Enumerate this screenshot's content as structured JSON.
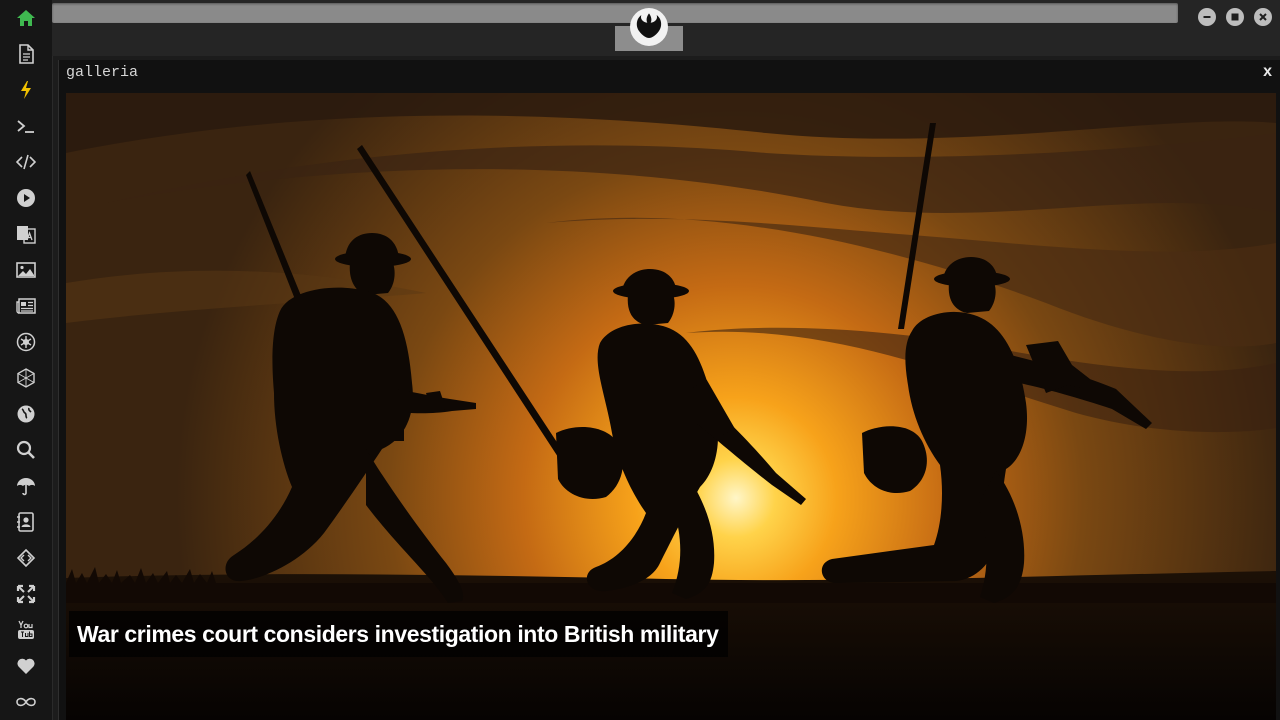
{
  "sidebar": {
    "items": [
      {
        "icon": "home-icon",
        "color": "#3fb950"
      },
      {
        "icon": "document-icon",
        "color": "#d0d0d0"
      },
      {
        "icon": "lightning-icon",
        "color": "#f2c200"
      },
      {
        "icon": "terminal-icon",
        "color": "#d0d0d0"
      },
      {
        "icon": "code-icon",
        "color": "#d0d0d0"
      },
      {
        "icon": "play-icon",
        "color": "#d0d0d0"
      },
      {
        "icon": "translate-icon",
        "color": "#d0d0d0"
      },
      {
        "icon": "image-icon",
        "color": "#d0d0d0"
      },
      {
        "icon": "newspaper-icon",
        "color": "#d0d0d0"
      },
      {
        "icon": "rebel-icon",
        "color": "#d0d0d0"
      },
      {
        "icon": "hexagon-icon",
        "color": "#d0d0d0"
      },
      {
        "icon": "globe-icon",
        "color": "#d0d0d0"
      },
      {
        "icon": "search-icon",
        "color": "#d0d0d0"
      },
      {
        "icon": "umbrella-icon",
        "color": "#d0d0d0"
      },
      {
        "icon": "contacts-icon",
        "color": "#d0d0d0"
      },
      {
        "icon": "code-diamond-icon",
        "color": "#d0d0d0"
      },
      {
        "icon": "expand-icon",
        "color": "#d0d0d0"
      },
      {
        "icon": "youtube-icon",
        "color": "#d0d0d0"
      },
      {
        "icon": "heart-icon",
        "color": "#d0d0d0"
      },
      {
        "icon": "infinity-icon",
        "color": "#d0d0d0"
      }
    ]
  },
  "window": {
    "controls": [
      "minimize-icon",
      "maximize-icon",
      "close-icon"
    ]
  },
  "panel": {
    "title": "galleria",
    "close_label": "x"
  },
  "gallery": {
    "caption": "War crimes court considers investigation into British military"
  }
}
